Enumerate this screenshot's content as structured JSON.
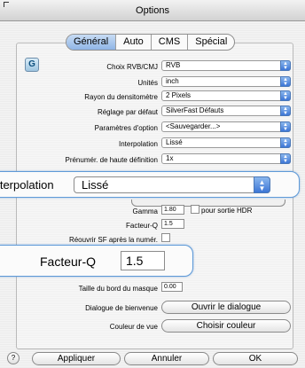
{
  "window": {
    "title": "Options"
  },
  "tabs": [
    {
      "label": "Général",
      "active": true
    },
    {
      "label": "Auto",
      "active": false
    },
    {
      "label": "CMS",
      "active": false
    },
    {
      "label": "Spécial",
      "active": false
    }
  ],
  "app_icon": {
    "glyph": "G"
  },
  "settings": {
    "choix_rvb": {
      "label": "Choix RVB/CMJ",
      "value": "RVB"
    },
    "unites": {
      "label": "Unités",
      "value": "inch"
    },
    "rayon": {
      "label": "Rayon du densitomètre",
      "value": "2 Pixels"
    },
    "reglage": {
      "label": "Réglage par défaut",
      "value": "SilverFast Défauts"
    },
    "parametres": {
      "label": "Paramètres d'option",
      "value": "<Sauvegarder...>"
    },
    "interpolation": {
      "label": "Interpolation",
      "value": "Lissé"
    },
    "prenumer": {
      "label": "Prénumér. de haute définition",
      "value": "1x"
    },
    "gamma": {
      "label": "Gamma",
      "value": "1.80",
      "hdr_label": "pour sortie HDR"
    },
    "facteur_q": {
      "label": "Facteur-Q",
      "value": "1.5"
    },
    "reouvrir": {
      "label": "Réouvrir SF après la numér."
    },
    "taille_bord": {
      "label": "Taille du bord du masque",
      "value": "0.00"
    },
    "dialogue": {
      "label": "Dialogue de bienvenue",
      "button": "Ouvrir le dialogue"
    },
    "couleur": {
      "label": "Couleur de vue",
      "button": "Choisir couleur"
    }
  },
  "zoom_interpolation": {
    "label": "Interpolation",
    "value": "Lissé"
  },
  "zoom_facteur": {
    "label": "Facteur-Q",
    "value": "1.5"
  },
  "footer": {
    "help": "?",
    "apply": "Appliquer",
    "cancel": "Annuler",
    "ok": "OK"
  },
  "icons": {
    "dropdown": "⌃⌄"
  },
  "colors": {
    "accent": "#3c76d6",
    "highlight": "#5f9ad8"
  }
}
